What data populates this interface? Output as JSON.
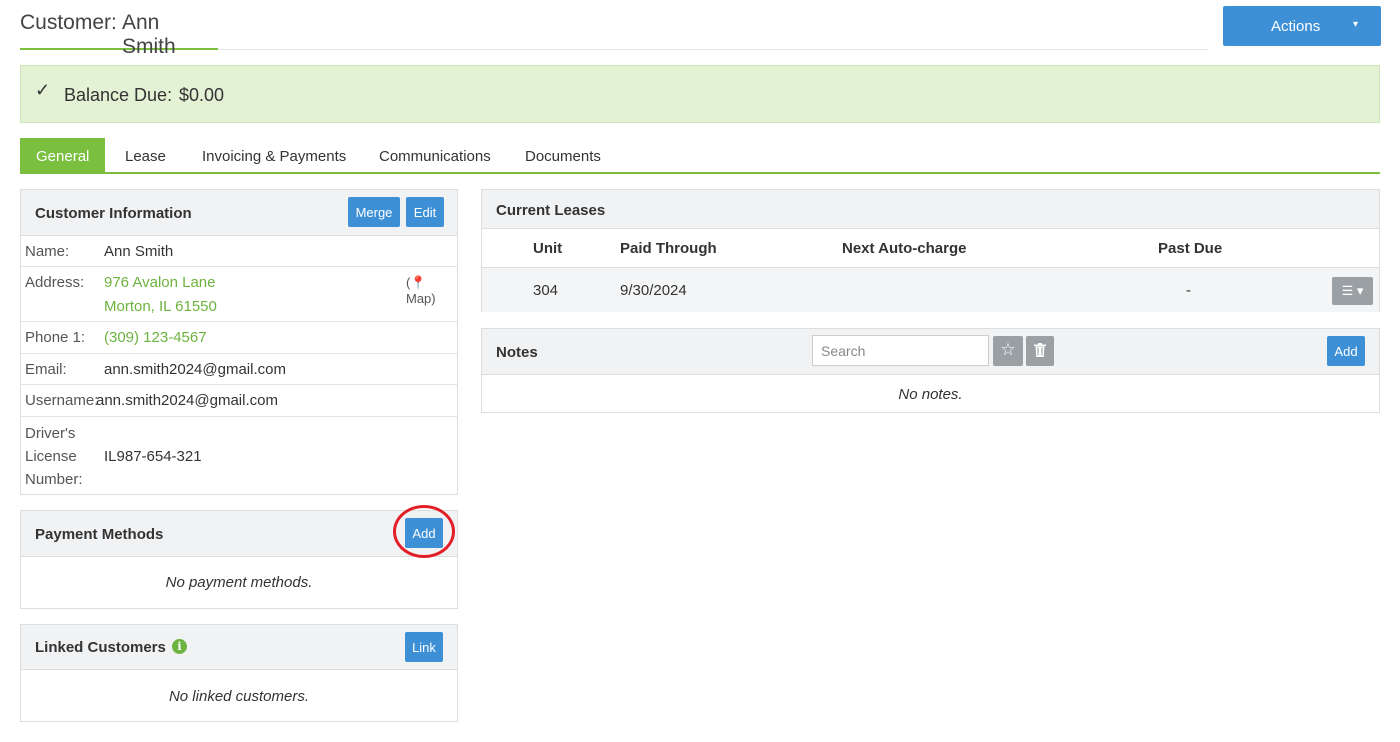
{
  "header": {
    "title_prefix": "Customer:",
    "customer_name": "Ann Smith",
    "actions_label": "Actions",
    "actions_caret": "▾"
  },
  "balance": {
    "check_glyph": "✓",
    "label": "Balance Due:",
    "amount": "$0.00"
  },
  "tabs": [
    {
      "label": "General",
      "active": true
    },
    {
      "label": "Lease",
      "active": false
    },
    {
      "label": "Invoicing & Payments",
      "active": false
    },
    {
      "label": "Communications",
      "active": false
    },
    {
      "label": "Documents",
      "active": false
    }
  ],
  "customer_info": {
    "title": "Customer Information",
    "merge_label": "Merge",
    "edit_label": "Edit",
    "name_label": "Name:",
    "name": "Ann Smith",
    "address_label": "Address:",
    "address_line1": "976 Avalon Lane",
    "address_line2": "Morton, IL 61550",
    "map_label": "(📍 Map)",
    "phone_label": "Phone 1:",
    "phone": "(309) 123-4567",
    "email_label": "Email:",
    "email": "ann.smith2024@gmail.com",
    "username_label": "Username:",
    "username": "ann.smith2024@gmail.com",
    "license_label_1": "Driver's",
    "license_label_2": "License",
    "license_label_3": "Number:",
    "license": "IL987-654-321"
  },
  "payment_methods": {
    "title": "Payment Methods",
    "add_label": "Add",
    "empty_text": "No payment methods."
  },
  "linked_customers": {
    "title": "Linked Customers",
    "info_glyph": "i",
    "link_label": "Link",
    "empty_text": "No linked customers."
  },
  "current_leases": {
    "title": "Current Leases",
    "columns": [
      "Unit",
      "Paid Through",
      "Next Auto-charge",
      "Past Due"
    ],
    "rows": [
      {
        "unit": "304",
        "paid_through": "9/30/2024",
        "next_auto_charge": "",
        "past_due": "-"
      }
    ],
    "row_menu_glyph": "☰ ▾"
  },
  "notes": {
    "title": "Notes",
    "search_placeholder": "Search",
    "star_glyph": "☆",
    "trash_glyph": "🗑",
    "add_label": "Add",
    "empty_text": "No notes."
  },
  "colors": {
    "accent_green": "#7bbf3f",
    "link_green": "#6db33f",
    "primary_blue": "#3d8fd6",
    "balance_bg": "#e3f1d5",
    "highlight_red": "#e41e26"
  }
}
